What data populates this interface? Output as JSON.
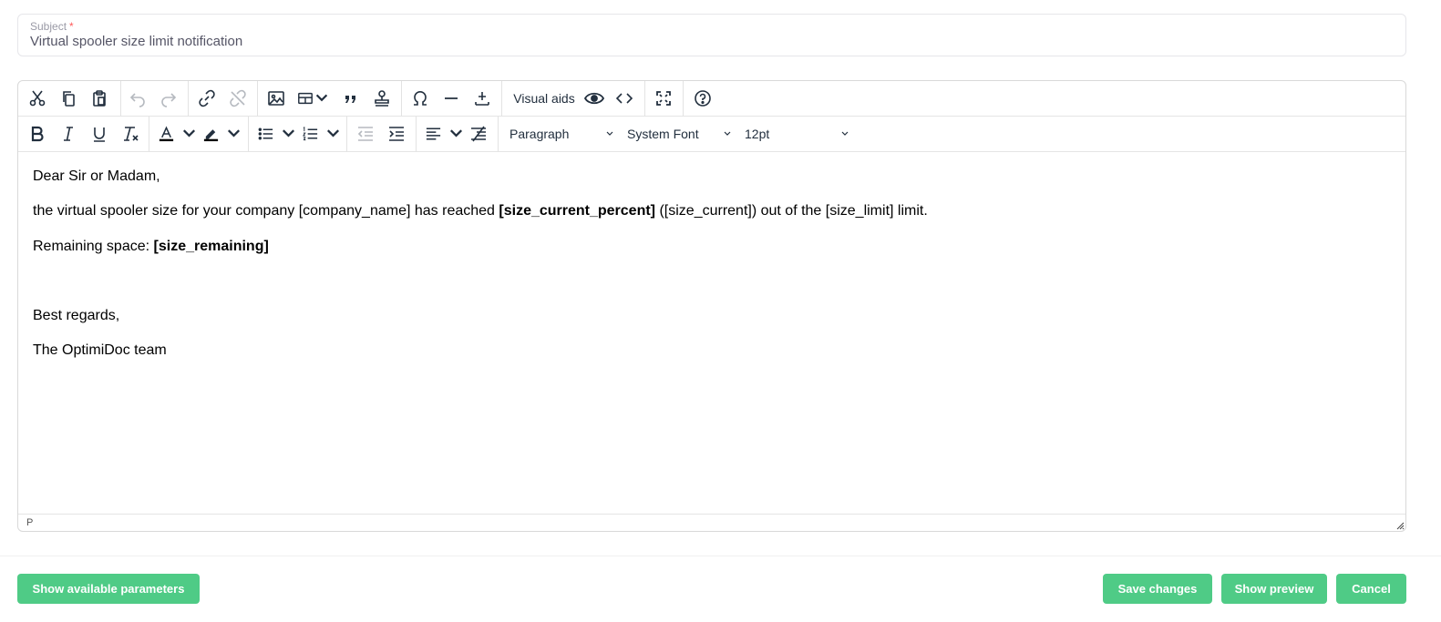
{
  "subject": {
    "label": "Subject",
    "required_mark": "*",
    "value": "Virtual spooler size limit notification"
  },
  "toolbar": {
    "visual_aids_label": "Visual aids",
    "format_select": "Paragraph",
    "font_select": "System Font",
    "size_select": "12pt",
    "icons": [
      "cut-icon",
      "copy-icon",
      "paste-icon",
      "undo-icon",
      "redo-icon",
      "link-icon",
      "unlink-icon",
      "image-icon",
      "table-icon",
      "blockquote-icon",
      "stamp-icon",
      "special-char-icon",
      "horizontal-rule-icon",
      "insert-icon",
      "eye-icon",
      "code-icon",
      "fullscreen-icon",
      "help-icon",
      "bold-icon",
      "italic-icon",
      "underline-icon",
      "clear-format-icon",
      "text-color-icon",
      "highlight-icon",
      "bullet-list-icon",
      "numbered-list-icon",
      "outdent-icon",
      "indent-icon",
      "align-left-icon",
      "line-height-icon"
    ]
  },
  "content": {
    "greeting": "Dear Sir or Madam,",
    "line2_pre": "the virtual spooler size for your company [company_name] has reached",
    "line2_bold": "[size_current_percent]",
    "line2_post": "([size_current]) out of the [size_limit] limit.",
    "line3_pre": "Remaining space:",
    "line3_bold": "[size_remaining]",
    "closing": "Best regards,",
    "signature": "The OptimiDoc team"
  },
  "statusbar": {
    "path": "P"
  },
  "footer": {
    "show_params": "Show available parameters",
    "save": "Save changes",
    "preview": "Show preview",
    "cancel": "Cancel"
  },
  "colors": {
    "accent": "#4fcb86",
    "required": "#ff5a5a"
  }
}
